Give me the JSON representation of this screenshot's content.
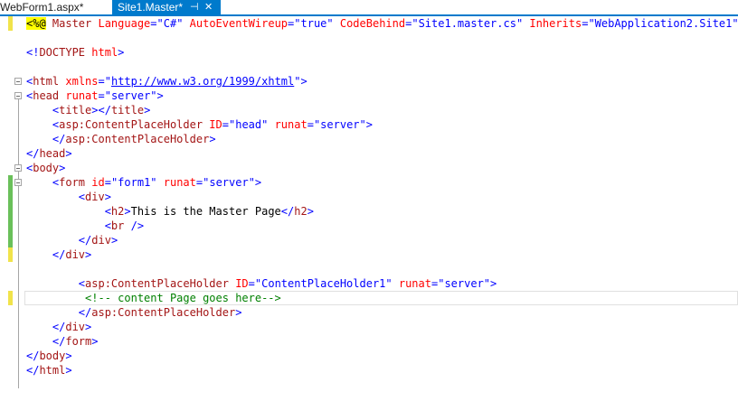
{
  "tabs": [
    {
      "label": "WebForm1.aspx*",
      "active": false
    },
    {
      "label": "Site1.Master*",
      "active": true,
      "pin_glyph": "⊣",
      "close_glyph": "✕"
    }
  ],
  "code_lines": {
    "l1": {
      "a": "<%@",
      "b": " Master ",
      "c": "Language",
      "d": "=",
      "e": "\"C#\"",
      "f": " ",
      "g": "AutoEventWireup",
      "h": "=",
      "i": "\"true\"",
      "j": " ",
      "k": "CodeBehind",
      "l": "=",
      "m": "\"Site1.master.cs\"",
      "n": " ",
      "o": "Inherits",
      "p": "=",
      "q": "\"WebApplication2.Site1\"",
      "r": " ",
      "s": "%>"
    },
    "l3": {
      "a": "<!",
      "b": "DOCTYPE",
      "c": " ",
      "d": "html",
      "e": ">"
    },
    "l5": {
      "a": "<",
      "b": "html",
      "c": " xmlns",
      "d": "=",
      "e": "\"",
      "f": "http://www.w3.org/1999/xhtml",
      "g": "\"",
      "h": ">"
    },
    "l6": {
      "a": "<",
      "b": "head",
      "c": " runat",
      "d": "=",
      "e": "\"server\"",
      "f": ">"
    },
    "l7": {
      "a": "    <",
      "b": "title",
      "c": "></",
      "d": "title",
      "e": ">"
    },
    "l8": {
      "a": "    <",
      "b": "asp:ContentPlaceHolder",
      "c": " ID",
      "d": "=",
      "e": "\"head\"",
      "f": " runat",
      "g": "=",
      "h": "\"server\"",
      "i": ">"
    },
    "l9": {
      "a": "    </",
      "b": "asp:ContentPlaceHolder",
      "c": ">"
    },
    "l10": {
      "a": "</",
      "b": "head",
      "c": ">"
    },
    "l11": {
      "a": "<",
      "b": "body",
      "c": ">"
    },
    "l12": {
      "a": "    <",
      "b": "form",
      "c": " id",
      "d": "=",
      "e": "\"form1\"",
      "f": " runat",
      "g": "=",
      "h": "\"server\"",
      "i": ">"
    },
    "l13": {
      "a": "        <",
      "b": "div",
      "c": ">"
    },
    "l14": {
      "a": "            <",
      "b": "h2",
      "c": ">",
      "d": "This is the Master Page",
      "e": "</",
      "f": "h2",
      "g": ">"
    },
    "l15": {
      "a": "            <",
      "b": "br",
      "c": " />"
    },
    "l16": {
      "a": "        </",
      "b": "div",
      "c": ">"
    },
    "l17": {
      "a": "    </",
      "b": "div",
      "c": ">"
    },
    "l19": {
      "a": "        <",
      "b": "asp:ContentPlaceHolder",
      "c": " ID",
      "d": "=",
      "e": "\"ContentPlaceHolder1\"",
      "f": " runat",
      "g": "=",
      "h": "\"server\"",
      "i": ">"
    },
    "l20": {
      "a": "         <!-- content Page goes here-->"
    },
    "l21": {
      "a": "        </",
      "b": "asp:ContentPlaceHolder",
      "c": ">"
    },
    "l22": {
      "a": "    </",
      "b": "div",
      "c": ">"
    },
    "l23": {
      "a": "    </",
      "b": "form",
      "c": ">"
    },
    "l24": {
      "a": "</",
      "b": "body",
      "c": ">"
    },
    "l25": {
      "a": "</",
      "b": "html",
      "c": ">"
    }
  },
  "colors": {
    "tab_active_bg": "#007acc",
    "tag": "#a31515",
    "attribute": "#ff0000",
    "value": "#0000ff",
    "comment": "#008000",
    "directive_highlight": "#ffff00",
    "change_saved": "#6ac05a",
    "change_unsaved": "#f1e34a"
  }
}
